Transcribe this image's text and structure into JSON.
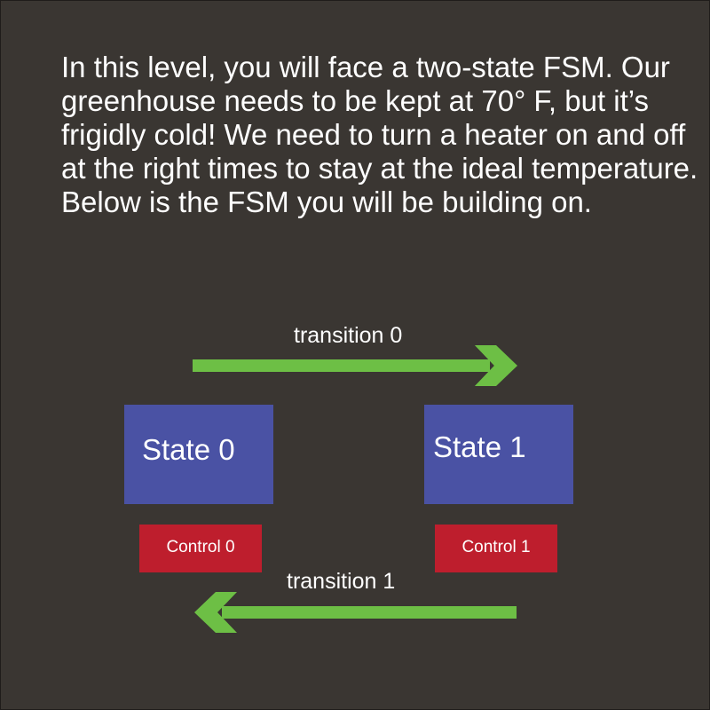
{
  "intro": {
    "text": "In this level, you will face a two-state FSM. Our greenhouse needs to be kept at 70° F, but it’s frigidly cold! We need to turn a heater on and off at the right times to stay at the ideal temperature. Below is the FSM you will be building on."
  },
  "fsm": {
    "states": [
      {
        "label": "State 0",
        "control": "Control 0"
      },
      {
        "label": "State 1",
        "control": "Control 1"
      }
    ],
    "transitions": [
      {
        "label": "transition 0",
        "direction": "right"
      },
      {
        "label": "transition 1",
        "direction": "left"
      }
    ]
  },
  "colors": {
    "background": "#3a3632",
    "state": "#4a52a4",
    "control": "#be1e2d",
    "arrow": "#6dbf45",
    "text": "#ffffff"
  }
}
